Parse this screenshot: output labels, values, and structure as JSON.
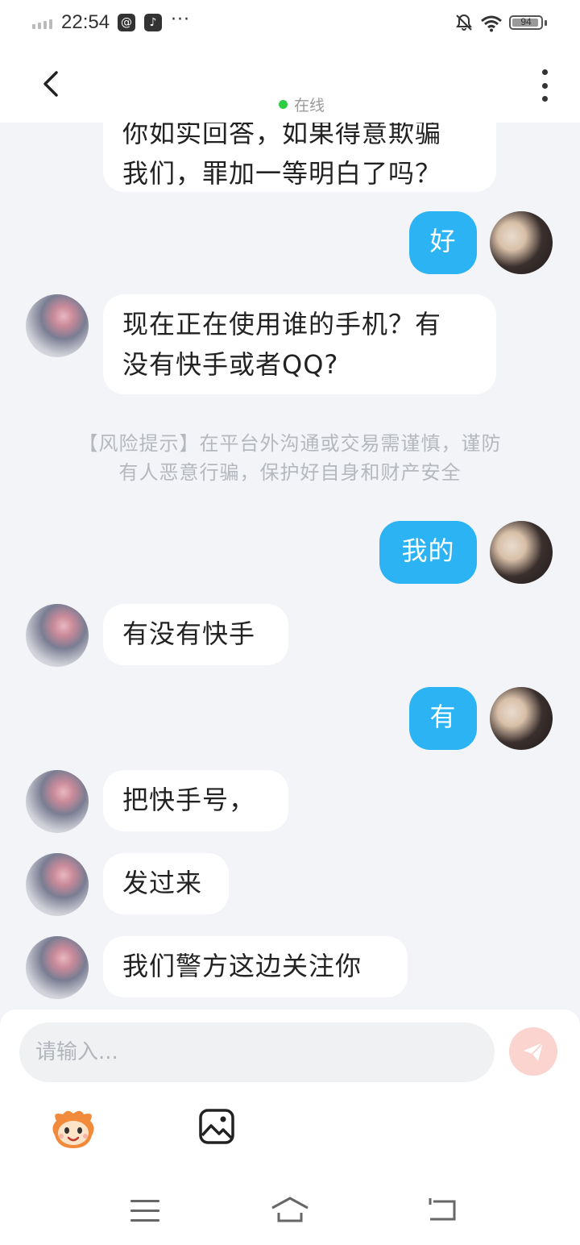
{
  "status_bar": {
    "time": "22:54",
    "battery": "94",
    "battery_level": 0.94
  },
  "header": {
    "status": "在线"
  },
  "messages": [
    {
      "side": "left",
      "avatar": "contact-avatar",
      "text_lines": [
        "你如实回答，如果得意欺骗",
        "我们，罪加一等明白了吗？"
      ]
    },
    {
      "side": "right",
      "avatar": "my-avatar",
      "text": "好"
    },
    {
      "side": "left",
      "avatar": "contact-avatar",
      "text_lines": [
        "现在正在使用谁的手机？有",
        "没有快手或者QQ?"
      ]
    },
    {
      "side": "right",
      "avatar": "my-avatar",
      "text": "我的"
    },
    {
      "side": "left",
      "avatar": "contact-avatar",
      "text": "有没有快手"
    },
    {
      "side": "right",
      "avatar": "my-avatar",
      "text": "有"
    },
    {
      "side": "left",
      "avatar": "contact-avatar",
      "text": "把快手号，"
    },
    {
      "side": "left",
      "avatar": "contact-avatar",
      "text": "发过来"
    },
    {
      "side": "left",
      "avatar": "contact-avatar",
      "text": "我们警方这边关注你"
    }
  ],
  "risk_notice": {
    "line1": "【风险提示】在平台外沟通或交易需谨慎，谨防",
    "line2": "有人恶意行骗，保护好自身和财产安全"
  },
  "input": {
    "placeholder": "请输入...",
    "value": ""
  },
  "toolbar": {
    "emoji_icon": "emoji-icon",
    "image_icon": "image-icon",
    "send_icon": "send-icon"
  },
  "colors": {
    "bubble_me": "#2bb3f3",
    "bubble_other": "#ffffff",
    "send_button": "#fbd3cf",
    "online_dot": "#2ecc40",
    "background": "#f2f4f7"
  }
}
